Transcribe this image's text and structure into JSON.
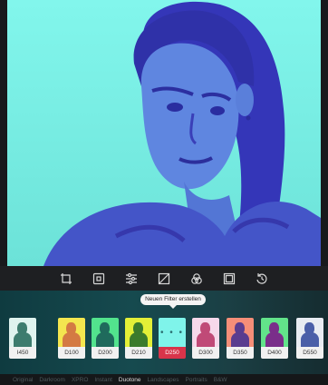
{
  "toolbar": {
    "tools": [
      {
        "name": "crop-icon"
      },
      {
        "name": "filter-icon",
        "active": true
      },
      {
        "name": "adjust-sliders-icon"
      },
      {
        "name": "curves-icon"
      },
      {
        "name": "color-circles-icon"
      },
      {
        "name": "frame-icon"
      },
      {
        "name": "history-icon"
      }
    ]
  },
  "tooltip": {
    "text": "Neuen Filter erstellen"
  },
  "filters": [
    {
      "label": "I450",
      "bg": "#dff3ee",
      "fig": "#3d7c6e"
    },
    {
      "label": "D100",
      "bg": "#f4e64f",
      "fig": "#d47a43"
    },
    {
      "label": "D200",
      "bg": "#52e38d",
      "fig": "#1f6a5c"
    },
    {
      "label": "D210",
      "bg": "#e4ef37",
      "fig": "#3b7b2c"
    },
    {
      "label": "D250",
      "bg": "#7ff4ea",
      "fig": "#2a6f70",
      "active": true,
      "more": "• • •"
    },
    {
      "label": "D300",
      "bg": "#f6d8ea",
      "fig": "#c04a77"
    },
    {
      "label": "D350",
      "bg": "#f58e78",
      "fig": "#5a3c8f"
    },
    {
      "label": "D400",
      "bg": "#62e38a",
      "fig": "#7a2e8a"
    },
    {
      "label": "D550",
      "bg": "#e8ecf2",
      "fig": "#4a5fa8"
    }
  ],
  "categories": [
    {
      "label": "Original"
    },
    {
      "label": "Darkroom"
    },
    {
      "label": "XPRO"
    },
    {
      "label": "Instant"
    },
    {
      "label": "Duotone",
      "active": true
    },
    {
      "label": "Landscapes"
    },
    {
      "label": "Portraits"
    },
    {
      "label": "B&W"
    }
  ],
  "colors": {
    "accent": "#d8344a",
    "duotone_light": "#7ff4ea",
    "duotone_dark": "#3b3cc8"
  }
}
